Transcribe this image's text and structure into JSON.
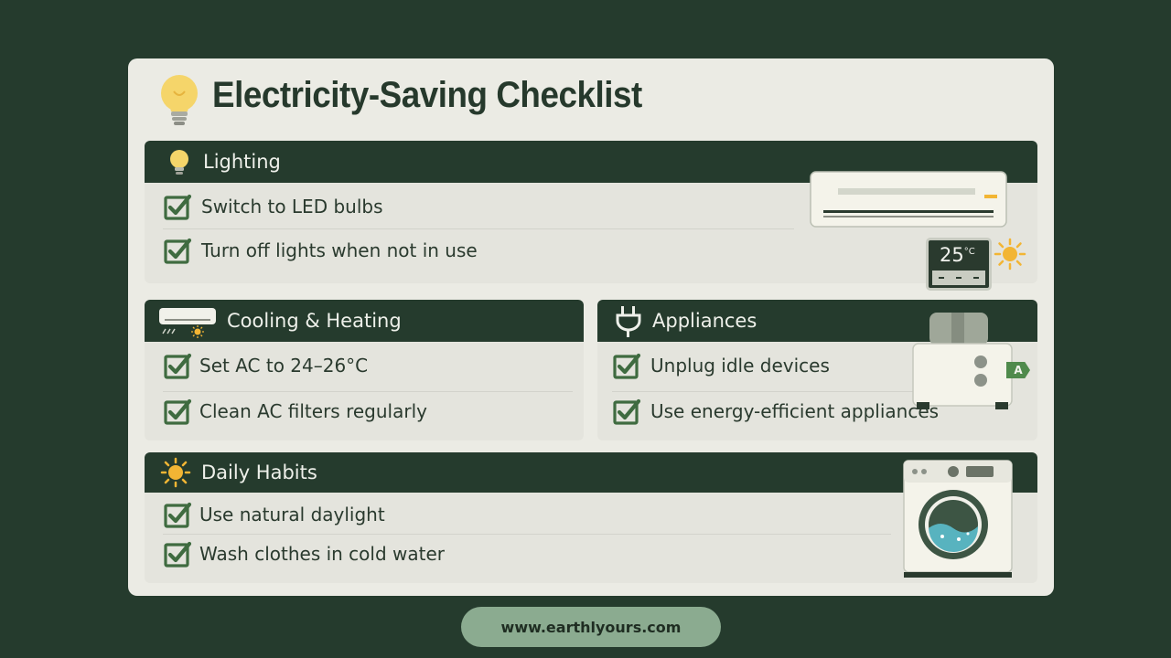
{
  "title": "Electricity-Saving Checklist",
  "sections": {
    "lighting": {
      "title": "Lighting",
      "items": [
        "Switch to LED bulbs",
        "Turn off lights when not in use"
      ]
    },
    "cooling": {
      "title": "Cooling & Heating",
      "items": [
        "Set AC to 24–26°C",
        "Clean AC filters regularly"
      ]
    },
    "appliances": {
      "title": "Appliances",
      "items": [
        "Unplug idle devices",
        "Use energy-efficient appliances"
      ]
    },
    "habits": {
      "title": "Daily Habits",
      "items": [
        "Use natural daylight",
        "Wash clothes in cold water"
      ]
    }
  },
  "thermostat": {
    "temp": "25",
    "unit": "°C"
  },
  "energy_label": "A",
  "footer": {
    "url": "www.earthlyours.com"
  },
  "colors": {
    "background": "#253b2d",
    "card": "#ebebe4",
    "header": "#253b2d",
    "check": "#3f6b40",
    "bulb": "#f5d56a",
    "sun": "#f2b534",
    "footer_pill": "#8bab90"
  },
  "icons": [
    "lightbulb-icon",
    "checkmark-icon",
    "air-conditioner-icon",
    "plug-icon",
    "sun-icon",
    "thermostat-icon",
    "toaster-icon",
    "washing-machine-icon"
  ]
}
